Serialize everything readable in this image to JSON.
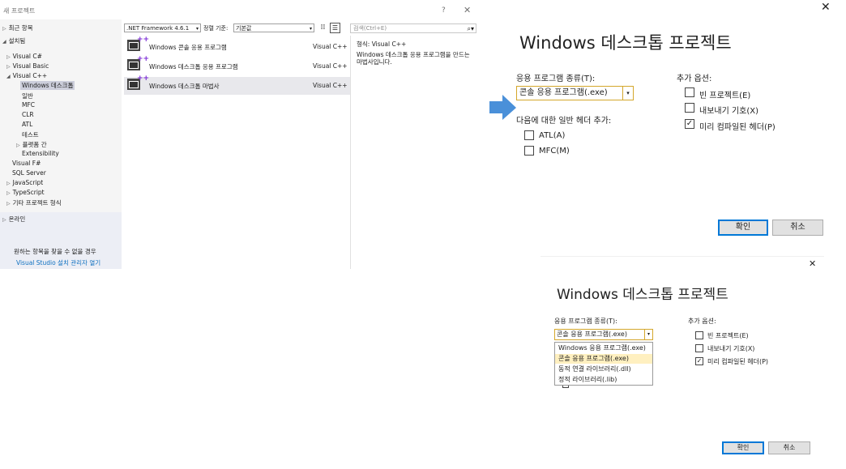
{
  "new_project": {
    "title": "새 프로젝트",
    "help": "?",
    "close": "✕",
    "tree": {
      "recent": "최근 항목",
      "installed": "설치됨",
      "visual_csharp": "Visual C#",
      "visual_basic": "Visual Basic",
      "visual_cpp": "Visual C++",
      "windows_desktop": "Windows 데스크톱",
      "general": "일반",
      "mfc": "MFC",
      "clr": "CLR",
      "atl": "ATL",
      "test": "테스트",
      "cross_platform": "플랫폼 간",
      "extensibility": "Extensibility",
      "visual_fsharp": "Visual F#",
      "sql_server": "SQL Server",
      "javascript": "JavaScript",
      "typescript": "TypeScript",
      "other_types": "기타 프로젝트 형식",
      "online": "온라인"
    },
    "framework": ".NET Framework 4.6.1",
    "sort_label": "정렬 기준:",
    "sort_value": "기본값",
    "search_placeholder": "검색(Ctrl+E)",
    "templates": [
      {
        "name": "Windows 콘솔 응용 프로그램",
        "lang": "Visual C++"
      },
      {
        "name": "Windows 데스크톱 응용 프로그램",
        "lang": "Visual C++"
      },
      {
        "name": "Windows 데스크톱 마법사",
        "lang": "Visual C++"
      }
    ],
    "detail_type": "형식:  Visual C++",
    "detail_desc": "Windows 데스크톱 응용 프로그램을 만드는 마법사입니다.",
    "footer_text": "원하는 항목을 찾을 수 없을 경우",
    "footer_link": "Visual Studio 설치 관리자 열기"
  },
  "wizard_top": {
    "close": "✕",
    "heading": "Windows 데스크톱 프로젝트",
    "app_type_label": "응용 프로그램 종류(T):",
    "app_type_value": "콘솔 응용 프로그램(.exe)",
    "headers_label": "다음에 대한 일반 헤더 추가:",
    "atl": "ATL(A)",
    "mfc": "MFC(M)",
    "options_label": "추가 옵션:",
    "empty_project": "빈 프로젝트(E)",
    "export_symbols": "내보내기 기호(X)",
    "precompiled_header": "미리 컴파일된 헤더(P)",
    "ok": "확인",
    "cancel": "취소",
    "check": "✓"
  },
  "wizard_bottom": {
    "close": "✕",
    "heading": "Windows 데스크톱 프로젝트",
    "app_type_label": "응용 프로그램 종류(T):",
    "app_type_value": "콘솔 응용 프로그램(.exe)",
    "options_label": "추가 옵션:",
    "dropdown_options": [
      "Windows 응용 프로그램(.exe)",
      "콘솔 응용 프로그램(.exe)",
      "동적 연결 라이브러리(.dll)",
      "정적 라이브러리(.lib)"
    ],
    "empty_project": "빈 프로젝트(E)",
    "export_symbols": "내보내기 기호(X)",
    "precompiled_header": "미리 컴파일된 헤더(P)",
    "ok": "확인",
    "cancel": "취소",
    "check": "✓"
  },
  "colors": {
    "arrow_fill": "#4a90d9",
    "combo_border": "#d4a72c",
    "primary_border": "#0078d7",
    "link": "#0e70c0",
    "selected_option": "#fff0c0"
  }
}
